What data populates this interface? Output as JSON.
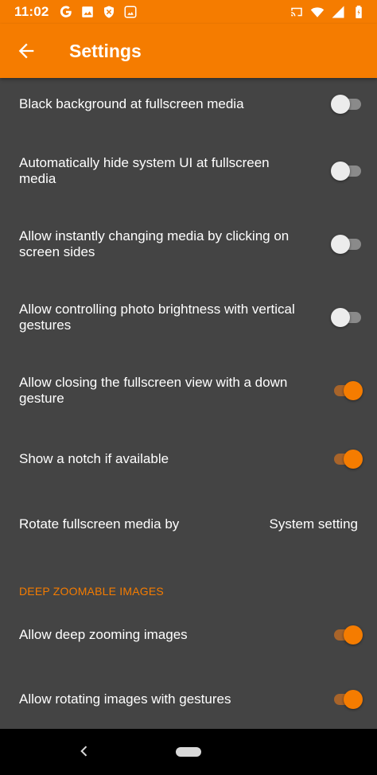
{
  "status_bar": {
    "time": "11:02",
    "left_icons": [
      "google-icon",
      "image-icon",
      "shield-icon",
      "photo-frame-icon"
    ],
    "right_icons": [
      "cast-icon",
      "wifi-icon",
      "signal-icon",
      "battery-icon"
    ]
  },
  "app_bar": {
    "title": "Settings",
    "back_icon": "arrow-left-icon"
  },
  "settings": [
    {
      "label": "Black background at fullscreen media",
      "enabled": false
    },
    {
      "label": "Automatically hide system UI at fullscreen media",
      "enabled": false
    },
    {
      "label": "Allow instantly changing media by clicking on screen sides",
      "enabled": false
    },
    {
      "label": "Allow controlling photo brightness with vertical gestures",
      "enabled": false
    },
    {
      "label": "Allow closing the fullscreen view with a down gesture",
      "enabled": true
    },
    {
      "label": "Show a notch if available",
      "enabled": true
    }
  ],
  "rotate_setting": {
    "label": "Rotate fullscreen media by",
    "value": "System setting"
  },
  "deep_zoom_section": {
    "header": "DEEP ZOOMABLE IMAGES",
    "items": [
      {
        "label": "Allow deep zooming images",
        "enabled": true
      },
      {
        "label": "Allow rotating images with gestures",
        "enabled": true
      }
    ]
  },
  "colors": {
    "accent": "#f57c00",
    "background": "#444444",
    "text": "#ffffff"
  },
  "nav_bar": {
    "back_icon": "nav-back-icon",
    "home_icon": "home-pill-icon"
  }
}
